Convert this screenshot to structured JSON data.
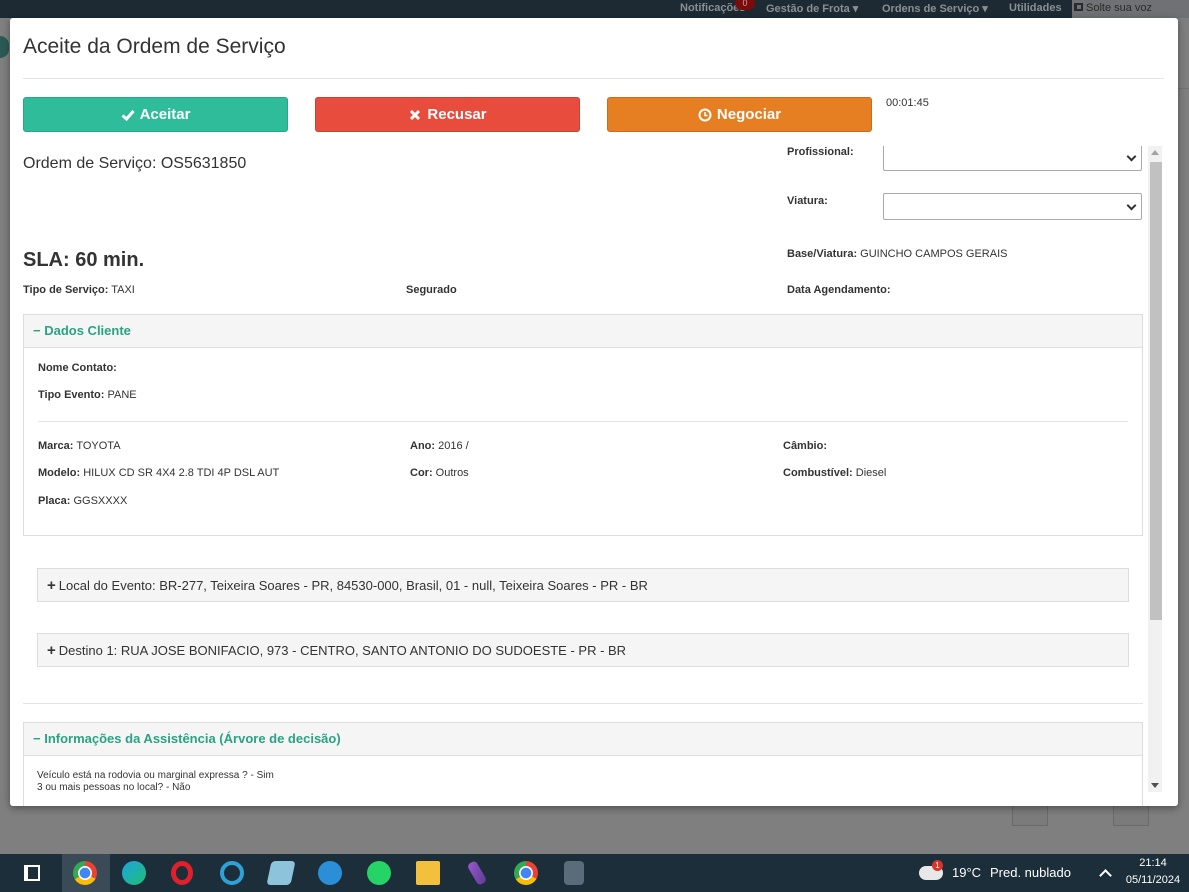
{
  "topnav": {
    "notifications_label": "Notificações",
    "notifications_count": "0",
    "fleet_label": "Gestão de Frota",
    "orders_label": "Ordens de Serviço",
    "utilities_label": "Utilidades",
    "voice_label": "Solte sua voz"
  },
  "modal": {
    "title": "Aceite da Ordem de Serviço",
    "accept_label": "Aceitar",
    "reject_label": "Recusar",
    "negotiate_label": "Negociar",
    "timer": "00:01:45"
  },
  "order": {
    "number_label": "Ordem de Serviço: OS5631850",
    "sla": "SLA: 60 min.",
    "service_type_label": "Tipo de Serviço:",
    "service_type_value": "TAXI",
    "insured_label": "Segurado",
    "schedule_label": "Data Agendamento:",
    "professional_label": "Profissional:",
    "professional_value": "",
    "vehicle_label": "Viatura:",
    "vehicle_value": "",
    "base_label": "Base/Viatura:",
    "base_value": "GUINCHO CAMPOS GERAIS"
  },
  "client_panel": {
    "title": "Dados Cliente",
    "contact_label": "Nome Contato:",
    "contact_value": "",
    "event_type_label": "Tipo Evento:",
    "event_type_value": "PANE",
    "brand_label": "Marca:",
    "brand_value": "TOYOTA",
    "year_label": "Ano:",
    "year_value": "2016 /",
    "gearbox_label": "Câmbio:",
    "gearbox_value": "",
    "model_label": "Modelo:",
    "model_value": "HILUX CD SR 4X4 2.8 TDI 4P DSL AUT",
    "color_label": "Cor:",
    "color_value": "Outros",
    "fuel_label": "Combustível:",
    "fuel_value": "Diesel",
    "plate_label": "Placa:",
    "plate_value": "GGSXXXX"
  },
  "locations": {
    "event_location": "Local do Evento: BR-277, Teixeira Soares - PR, 84530-000, Brasil, 01 - null, Teixeira Soares - PR - BR",
    "destination": "Destino 1: RUA JOSE BONIFACIO, 973 - CENTRO, SANTO ANTONIO DO SUDOESTE - PR - BR"
  },
  "assistance_panel": {
    "title": "Informações da Assistência (Árvore de decisão)",
    "lines": [
      "Veículo está na rodovia ou marginal expressa ? - Sim",
      "3 ou mais pessoas no local? - Não"
    ]
  },
  "taskbar": {
    "weather_temp": "19°C",
    "weather_desc": "Pred. nublado",
    "weather_badge": "1",
    "time": "21:14",
    "date": "05/11/2024"
  },
  "colors": {
    "accept": "#2fbc9b",
    "reject": "#e74c3c",
    "negotiate": "#e67e22",
    "panel_title": "#2aa384"
  },
  "icons": [
    "check-icon",
    "times-icon",
    "clock-icon",
    "minus-icon",
    "plus-icon",
    "chevron-down-icon",
    "megaphone-icon"
  ]
}
